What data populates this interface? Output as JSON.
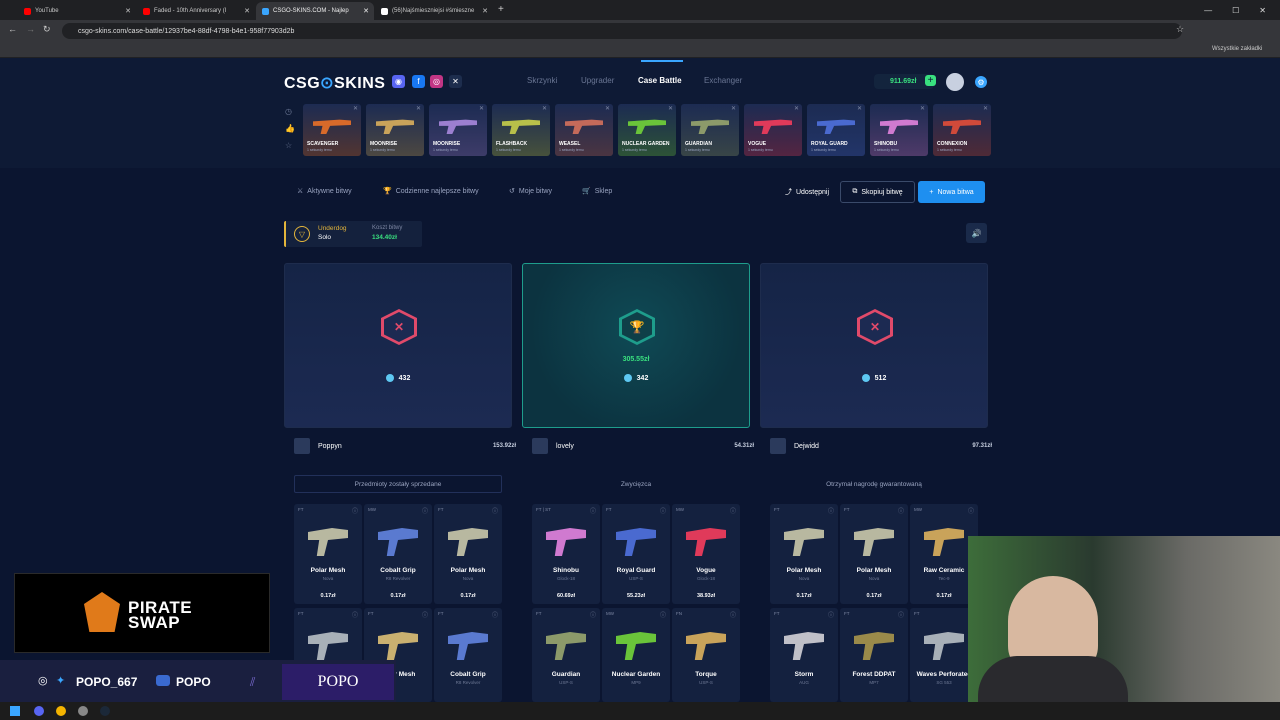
{
  "browser": {
    "tabs": [
      {
        "title": "YouTube",
        "color": "#ff0000"
      },
      {
        "title": "Faded - 10th Anniversary (I",
        "color": "#ff0000"
      },
      {
        "title": "CSGO-SKINS.COM - Najlep",
        "color": "#3aa6ff"
      },
      {
        "title": "(56)Najśmieszniejsi #śmieszne",
        "color": "#ffffff"
      }
    ],
    "url": "csgo-skins.com/case-battle/12937be4-88df-4798-b4e1-958f77903d2b",
    "bookmarks_label": "Wszystkie zakładki"
  },
  "site": {
    "logo_left": "CSG",
    "logo_right": "SKINS",
    "nav": [
      "Skrzynki",
      "Upgrader",
      "Case Battle",
      "Exchanger"
    ],
    "active_nav": "Case Battle",
    "balance": "911.69zł"
  },
  "drops": [
    {
      "name": "SCAVENGER",
      "sub": "1 sekundy temu",
      "color": "#d86a2a"
    },
    {
      "name": "MOONRISE",
      "sub": "1 sekundy temu",
      "color": "#c9a35a"
    },
    {
      "name": "MOONRISE",
      "sub": "1 sekundy temu",
      "color": "#9c7fd0"
    },
    {
      "name": "FLASHBACK",
      "sub": "1 sekundy temu",
      "color": "#b8c04a"
    },
    {
      "name": "WEASEL",
      "sub": "1 sekundy temu",
      "color": "#c46a5a"
    },
    {
      "name": "NUCLEAR GARDEN",
      "sub": "1 sekundy temu",
      "color": "#6ac43a"
    },
    {
      "name": "GUARDIAN",
      "sub": "1 sekundy temu",
      "color": "#8c9a6a"
    },
    {
      "name": "VOGUE",
      "sub": "1 sekundy temu",
      "color": "#e03a5a"
    },
    {
      "name": "ROYAL GUARD",
      "sub": "1 sekundy temu",
      "color": "#4a6ad0"
    },
    {
      "name": "SHINOBU",
      "sub": "1 sekundy temu",
      "color": "#d07ad0"
    },
    {
      "name": "CONNEXION",
      "sub": "1 sekundy temu",
      "color": "#d04a3a"
    }
  ],
  "battle_nav": {
    "active": "Aktywne bitwy",
    "daily": "Codzienne najlepsze bitwy",
    "mine": "Moje bitwy",
    "shop": "Sklep",
    "share": "Udostępnij",
    "copy": "Skopiuj bitwę",
    "new": "Nowa bitwa"
  },
  "battle_info": {
    "mode": "Underdog",
    "type": "Solo",
    "cost_label": "Koszt bitwy",
    "cost": "134.40zł"
  },
  "players": [
    {
      "points": "432",
      "win_amount": "",
      "name": "Poppyn",
      "total": "153.92zł",
      "status": "Przedmioty zostały sprzedane",
      "items": [
        {
          "cond": "FT",
          "name": "Polar Mesh",
          "sub": "Nova",
          "price": "0.17zł",
          "color": "#b8b8a0"
        },
        {
          "cond": "MW",
          "name": "Cobalt Grip",
          "sub": "R8 Revolver",
          "price": "0.17zł",
          "color": "#5a7ad0"
        },
        {
          "cond": "FT",
          "name": "Polar Mesh",
          "sub": "Nova",
          "price": "0.17zł",
          "color": "#b8b8a0"
        },
        {
          "cond": "FT",
          "name": "Polar Mesh",
          "sub": "",
          "price": "",
          "color": "#a8b0b8"
        },
        {
          "cond": "FT",
          "name": "Polar Mesh",
          "sub": "",
          "price": "",
          "color": "#c9b070"
        },
        {
          "cond": "FT",
          "name": "Cobalt Grip",
          "sub": "R8 Revolver",
          "price": "",
          "color": "#5a7ad0"
        }
      ]
    },
    {
      "points": "342",
      "win_amount": "305.55zł",
      "name": "lovely",
      "total": "54.31zł",
      "status": "Zwycięzca",
      "items": [
        {
          "cond": "FT | ST",
          "name": "Shinobu",
          "sub": "Glock-18",
          "price": "60.69zł",
          "color": "#d07ad0"
        },
        {
          "cond": "FT",
          "name": "Royal Guard",
          "sub": "USP-S",
          "price": "55.23zł",
          "color": "#4a6ad0"
        },
        {
          "cond": "MW",
          "name": "Vogue",
          "sub": "Glock-18",
          "price": "38.93zł",
          "color": "#e03a5a"
        },
        {
          "cond": "FT",
          "name": "Guardian",
          "sub": "USP-S",
          "price": "",
          "color": "#8c9a6a"
        },
        {
          "cond": "MW",
          "name": "Nuclear Garden",
          "sub": "MP9",
          "price": "",
          "color": "#6ac43a"
        },
        {
          "cond": "FN",
          "name": "Torque",
          "sub": "USP-S",
          "price": "",
          "color": "#c9a35a"
        }
      ]
    },
    {
      "points": "512",
      "win_amount": "",
      "name": "Dejwidd",
      "total": "97.31zł",
      "status": "Otrzymał nagrodę gwarantowaną",
      "items": [
        {
          "cond": "FT",
          "name": "Polar Mesh",
          "sub": "Nova",
          "price": "0.17zł",
          "color": "#b8b8a0"
        },
        {
          "cond": "FT",
          "name": "Polar Mesh",
          "sub": "Nova",
          "price": "0.17zł",
          "color": "#b8b8a0"
        },
        {
          "cond": "MW",
          "name": "Raw Ceramic",
          "sub": "Tec-9",
          "price": "0.17zł",
          "color": "#c9a35a"
        },
        {
          "cond": "FT",
          "name": "Storm",
          "sub": "AUG",
          "price": "",
          "color": "#c0c0c8"
        },
        {
          "cond": "FT",
          "name": "Forest DDPAT",
          "sub": "MP7",
          "price": "",
          "color": "#9a8a4a"
        },
        {
          "cond": "FT",
          "name": "Waves Perforated",
          "sub": "SG 553",
          "price": "",
          "color": "#a8b0b8"
        }
      ]
    }
  ],
  "overlay": {
    "brand_line1": "PIRATE",
    "brand_line2": "SWAP",
    "handle": "POPO_667",
    "yt_name": "POPO",
    "box_name": "POPO"
  }
}
